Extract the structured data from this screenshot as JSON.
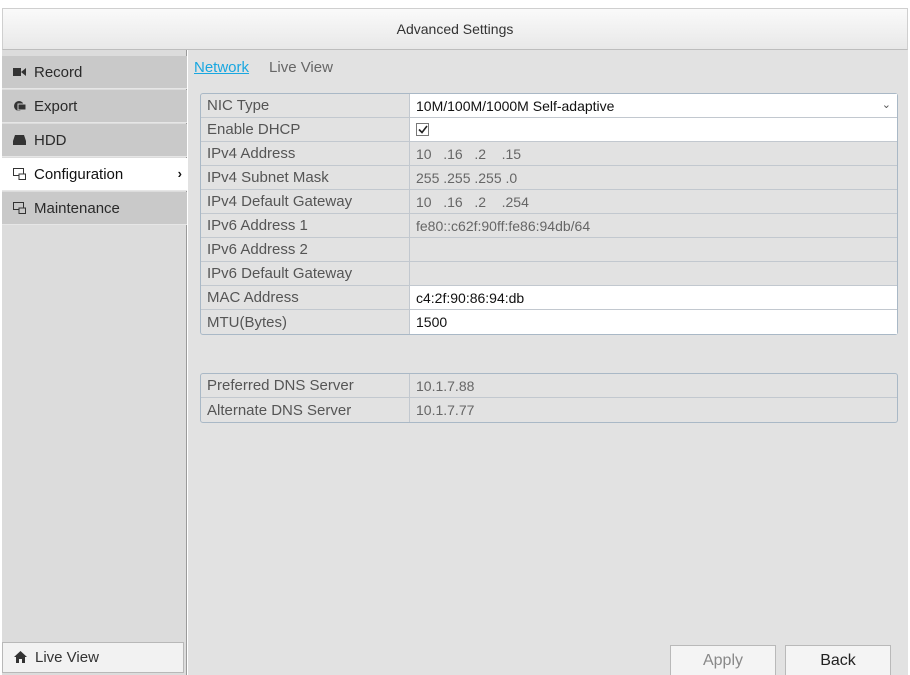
{
  "window": {
    "title": "Advanced Settings"
  },
  "sidebar": {
    "items": [
      {
        "label": "Record",
        "icon": "record-icon"
      },
      {
        "label": "Export",
        "icon": "export-icon"
      },
      {
        "label": "HDD",
        "icon": "hdd-icon"
      },
      {
        "label": "Configuration",
        "icon": "configuration-icon",
        "active": true
      },
      {
        "label": "Maintenance",
        "icon": "maintenance-icon"
      }
    ],
    "bottom": {
      "label": "Live View",
      "icon": "home-icon"
    }
  },
  "tabs": [
    {
      "label": "Network",
      "active": true
    },
    {
      "label": "Live View",
      "active": false
    }
  ],
  "network": {
    "nic_type": {
      "label": "NIC Type",
      "value": "10M/100M/1000M Self-adaptive"
    },
    "enable_dhcp": {
      "label": "Enable DHCP",
      "checked": true
    },
    "ipv4_address": {
      "label": "IPv4 Address",
      "value": "10   .16   .2    .15"
    },
    "ipv4_mask": {
      "label": "IPv4 Subnet Mask",
      "value": "255 .255 .255 .0"
    },
    "ipv4_gateway": {
      "label": "IPv4 Default Gateway",
      "value": "10   .16   .2    .254"
    },
    "ipv6_address_1": {
      "label": "IPv6 Address 1",
      "value": "fe80::c62f:90ff:fe86:94db/64"
    },
    "ipv6_address_2": {
      "label": "IPv6 Address 2",
      "value": ""
    },
    "ipv6_gateway": {
      "label": "IPv6 Default Gateway",
      "value": ""
    },
    "mac_address": {
      "label": "MAC Address",
      "value": "c4:2f:90:86:94:db"
    },
    "mtu": {
      "label": "MTU(Bytes)",
      "value": "1500"
    }
  },
  "dns": {
    "preferred": {
      "label": "Preferred DNS Server",
      "value": "10.1.7.88"
    },
    "alternate": {
      "label": "Alternate DNS Server",
      "value": "10.1.7.77"
    }
  },
  "buttons": {
    "apply": "Apply",
    "back": "Back"
  },
  "colors": {
    "accent": "#19a7e0",
    "panel": "#e2e2e2",
    "sidebar": "#c9c9c9"
  }
}
